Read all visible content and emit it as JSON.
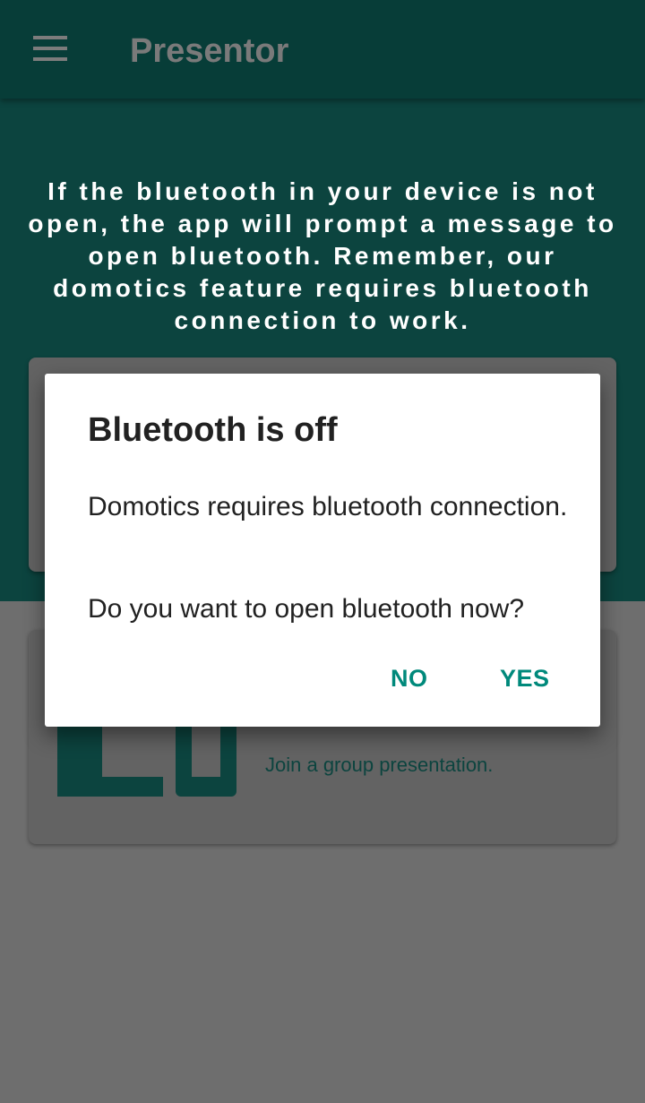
{
  "appbar": {
    "title": "Presentor",
    "menu_icon": "hamburger-menu-icon"
  },
  "hero": {
    "text": "If the bluetooth in your device is not open, the app will prompt a message to open bluetooth. Remember, our domotics feature requires bluetooth connection to work."
  },
  "join_card": {
    "subtitle": "Join a group presentation."
  },
  "dialog": {
    "title": "Bluetooth is off",
    "message": "Domotics requires bluetooth connection.",
    "question": "Do you want to open bluetooth now?",
    "no_label": "NO",
    "yes_label": "YES"
  },
  "colors": {
    "appbar": "#073d38",
    "hero_bg": "#0c443f",
    "accent": "#00897b",
    "scrim_bg": "#6e6e6e"
  }
}
